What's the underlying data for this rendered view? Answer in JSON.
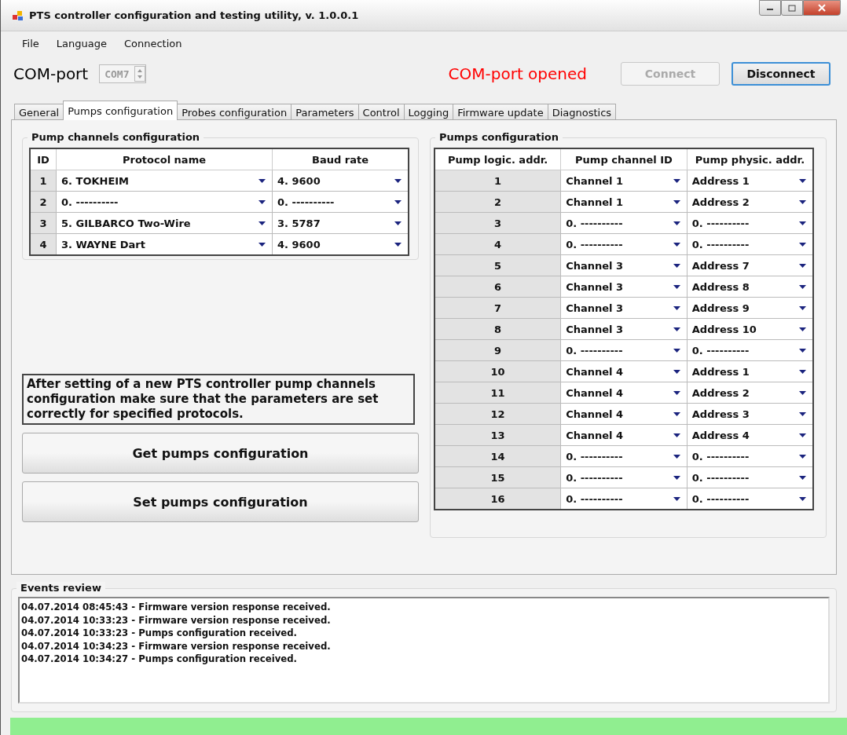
{
  "window": {
    "title": "PTS controller configuration and testing utility, v. 1.0.0.1"
  },
  "menu": [
    "File",
    "Language",
    "Connection"
  ],
  "com_port": {
    "label": "COM-port",
    "value": "COM7",
    "disabled": true,
    "status": "COM-port opened"
  },
  "buttons": [
    {
      "label": "Connect",
      "disabled": true
    },
    {
      "label": "Disconnect",
      "disabled": false
    }
  ],
  "tabs": [
    {
      "label": "General",
      "selected": false
    },
    {
      "label": "Pumps configuration",
      "selected": true
    },
    {
      "label": "Probes configuration",
      "selected": false
    },
    {
      "label": "Parameters",
      "selected": false
    },
    {
      "label": "Control",
      "selected": false
    },
    {
      "label": "Logging",
      "selected": false
    },
    {
      "label": "Firmware update",
      "selected": false
    },
    {
      "label": "Diagnostics",
      "selected": false
    }
  ],
  "pump_channels": {
    "title": "Pump channels configuration",
    "columns": [
      "ID",
      "Protocol name",
      "Baud rate"
    ],
    "rows": [
      {
        "id": "1",
        "protocol": "6. TOKHEIM",
        "baud": "4. 9600"
      },
      {
        "id": "2",
        "protocol": "0. ----------",
        "baud": "0. ----------"
      },
      {
        "id": "3",
        "protocol": "5. GILBARCO Two-Wire",
        "baud": "3. 5787"
      },
      {
        "id": "4",
        "protocol": "3. WAYNE Dart",
        "baud": "4. 9600"
      }
    ]
  },
  "note": "After setting of a new PTS controller pump channels configuration make sure that the parameters are set correctly for specified protocols.",
  "actions": [
    "Get pumps configuration",
    "Set pumps configuration"
  ],
  "pumps": {
    "title": "Pumps configuration",
    "columns": [
      "Pump logic. addr.",
      "Pump channel ID",
      "Pump physic. addr."
    ],
    "rows": [
      {
        "addr": "1",
        "channel": "Channel 1",
        "physic": "Address 1"
      },
      {
        "addr": "2",
        "channel": "Channel 1",
        "physic": "Address 2"
      },
      {
        "addr": "3",
        "channel": "0. ----------",
        "physic": "0. ----------"
      },
      {
        "addr": "4",
        "channel": "0. ----------",
        "physic": "0. ----------"
      },
      {
        "addr": "5",
        "channel": "Channel 3",
        "physic": "Address 7"
      },
      {
        "addr": "6",
        "channel": "Channel 3",
        "physic": "Address 8"
      },
      {
        "addr": "7",
        "channel": "Channel 3",
        "physic": "Address 9"
      },
      {
        "addr": "8",
        "channel": "Channel 3",
        "physic": "Address 10"
      },
      {
        "addr": "9",
        "channel": "0. ----------",
        "physic": "0. ----------"
      },
      {
        "addr": "10",
        "channel": "Channel 4",
        "physic": "Address 1"
      },
      {
        "addr": "11",
        "channel": "Channel 4",
        "physic": "Address 2"
      },
      {
        "addr": "12",
        "channel": "Channel 4",
        "physic": "Address 3"
      },
      {
        "addr": "13",
        "channel": "Channel 4",
        "physic": "Address 4"
      },
      {
        "addr": "14",
        "channel": "0. ----------",
        "physic": "0. ----------"
      },
      {
        "addr": "15",
        "channel": "0. ----------",
        "physic": "0. ----------"
      },
      {
        "addr": "16",
        "channel": "0. ----------",
        "physic": "0. ----------"
      }
    ]
  },
  "events": {
    "title": "Events review",
    "lines": [
      "04.07.2014 08:45:43 - Firmware version response received.",
      "04.07.2014 10:33:23 - Firmware version response received.",
      "04.07.2014 10:33:23 - Pumps configuration received.",
      "04.07.2014 10:34:23 - Firmware version response received.",
      "04.07.2014 10:34:27 - Pumps configuration received."
    ]
  }
}
